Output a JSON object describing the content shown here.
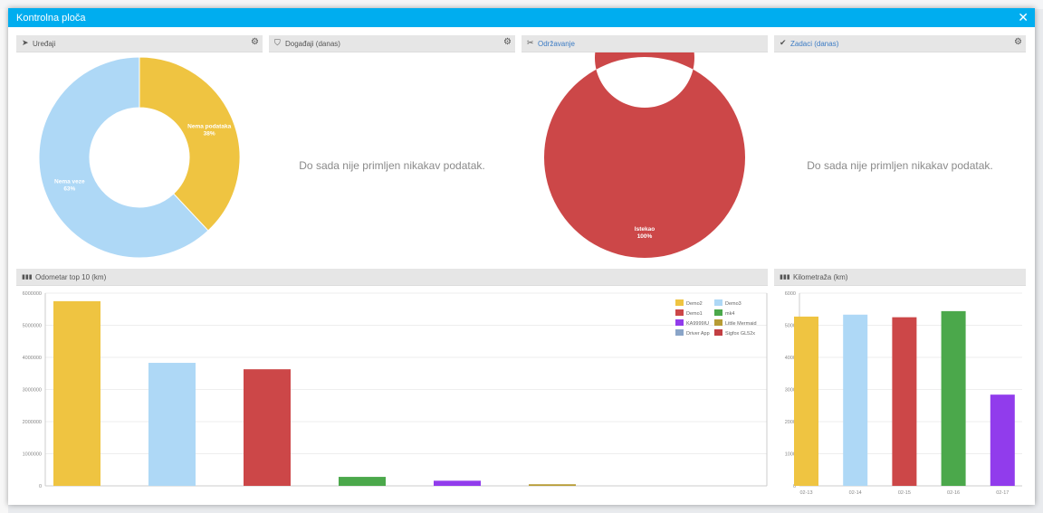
{
  "modal": {
    "title": "Kontrolna ploča",
    "close_icon": "close-icon"
  },
  "panels": {
    "devices": {
      "title": "Uređaji",
      "icon": "location-arrow-icon"
    },
    "events": {
      "title": "Događaji (danas)",
      "icon": "shield-icon",
      "empty_message": "Do sada nije primljen nikakav podatak."
    },
    "maintenance": {
      "title": "Održavanje",
      "icon": "tools-icon"
    },
    "tasks": {
      "title": "Zadaci (danas)",
      "icon": "check-icon",
      "empty_message": "Do sada nije primljen nikakav podatak."
    },
    "odometer": {
      "title": "Odometar top 10 (km)",
      "icon": "odometer-icon"
    },
    "mileage": {
      "title": "Kilometraža (km)",
      "icon": "odometer-icon"
    }
  },
  "colors": {
    "accent": "#00adef",
    "yellow": "#efc441",
    "light_blue": "#aed8f6",
    "red": "#cc4748",
    "green": "#4ba84b",
    "purple": "#913cec",
    "olive": "#b79c35",
    "steel": "#8aa5c8",
    "dark_red": "#c23f43"
  },
  "chart_data": [
    {
      "type": "pie",
      "id": "devices",
      "donut": true,
      "slices": [
        {
          "label": "Nema podataka",
          "value": 38,
          "label_text": "38%",
          "color": "#efc441"
        },
        {
          "label": "Nema veze",
          "value": 62,
          "label_text": "63%",
          "color": "#aed8f6"
        }
      ]
    },
    {
      "type": "pie",
      "id": "maintenance",
      "donut": true,
      "slices": [
        {
          "label": "Istekao",
          "value": 100,
          "label_text": "100%",
          "color": "#cc4748"
        }
      ]
    },
    {
      "type": "bar",
      "id": "odometer",
      "categories": [
        "Demo2",
        "Demo3",
        "Demo1",
        "mk4",
        "KA9999IU",
        "Little Mermaid"
      ],
      "values": [
        5750000,
        3830000,
        3630000,
        280000,
        160000,
        50000
      ],
      "colors": [
        "#efc441",
        "#aed8f6",
        "#cc4748",
        "#4ba84b",
        "#913cec",
        "#b79c35"
      ],
      "ylim": [
        0,
        6000000
      ],
      "yticks": [
        0,
        1000000,
        2000000,
        3000000,
        4000000,
        5000000,
        6000000
      ],
      "grid": true,
      "legend_position": "top-right",
      "legend": [
        {
          "name": "Demo2",
          "color": "#efc441"
        },
        {
          "name": "Demo3",
          "color": "#aed8f6"
        },
        {
          "name": "Demo1",
          "color": "#cc4748"
        },
        {
          "name": "mk4",
          "color": "#4ba84b"
        },
        {
          "name": "KA9999IU",
          "color": "#913cec"
        },
        {
          "name": "Little Mermaid",
          "color": "#b79c35"
        },
        {
          "name": "Driver App",
          "color": "#8aa5c8"
        },
        {
          "name": "Sigfox GL52x",
          "color": "#c23f43"
        }
      ]
    },
    {
      "type": "bar",
      "id": "mileage",
      "categories": [
        "02-13",
        "02-14",
        "02-15",
        "02-16",
        "02-17"
      ],
      "values": [
        5270,
        5330,
        5250,
        5440,
        2840
      ],
      "colors": [
        "#efc441",
        "#aed8f6",
        "#cc4748",
        "#4ba84b",
        "#913cec"
      ],
      "ylim": [
        0,
        6000
      ],
      "yticks": [
        0,
        1000,
        2000,
        3000,
        4000,
        5000,
        6000
      ],
      "grid": true
    }
  ]
}
